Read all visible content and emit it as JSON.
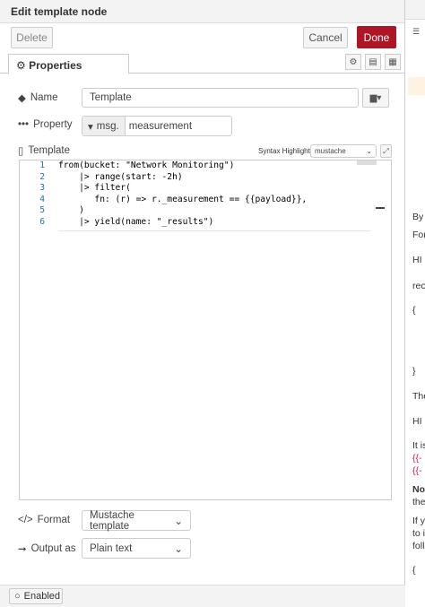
{
  "header": {
    "title": "Edit template node"
  },
  "toolbar": {
    "delete_label": "Delete",
    "cancel_label": "Cancel",
    "done_label": "Done"
  },
  "tabs": {
    "properties_label": "Properties"
  },
  "form": {
    "name": {
      "label": "Name",
      "value": "Template"
    },
    "property": {
      "label": "Property",
      "prefix": "msg.",
      "value": "measurement"
    },
    "template": {
      "label": "Template",
      "syntax_label": "Syntax Highlight:",
      "syntax_value": "mustache"
    },
    "format": {
      "label": "Format",
      "value": "Mustache template"
    },
    "output": {
      "label": "Output as",
      "value": "Plain text"
    }
  },
  "code_lines": [
    {
      "n": "1",
      "text": "from(bucket: \"Network Monitoring\")"
    },
    {
      "n": "2",
      "text": "    |> range(start: -2h)"
    },
    {
      "n": "3",
      "text": "    |> filter("
    },
    {
      "n": "4",
      "text": "       fn: (r) => r._measurement == {{payload}},"
    },
    {
      "n": "5",
      "text": "    )"
    },
    {
      "n": "6",
      "text": "    |> yield(name: \"_results\")"
    }
  ],
  "footer": {
    "enabled_label": "Enabled"
  },
  "sidebar": {
    "fragments": [
      "By",
      "For",
      "HI",
      "rec",
      "{",
      "}",
      "The",
      "HI",
      "It is",
      "{{-",
      "{{-",
      "Not",
      "the",
      "If y",
      "to i",
      "follo",
      "{"
    ]
  },
  "colors": {
    "done": "#ad1625",
    "line_number": "#237893"
  }
}
